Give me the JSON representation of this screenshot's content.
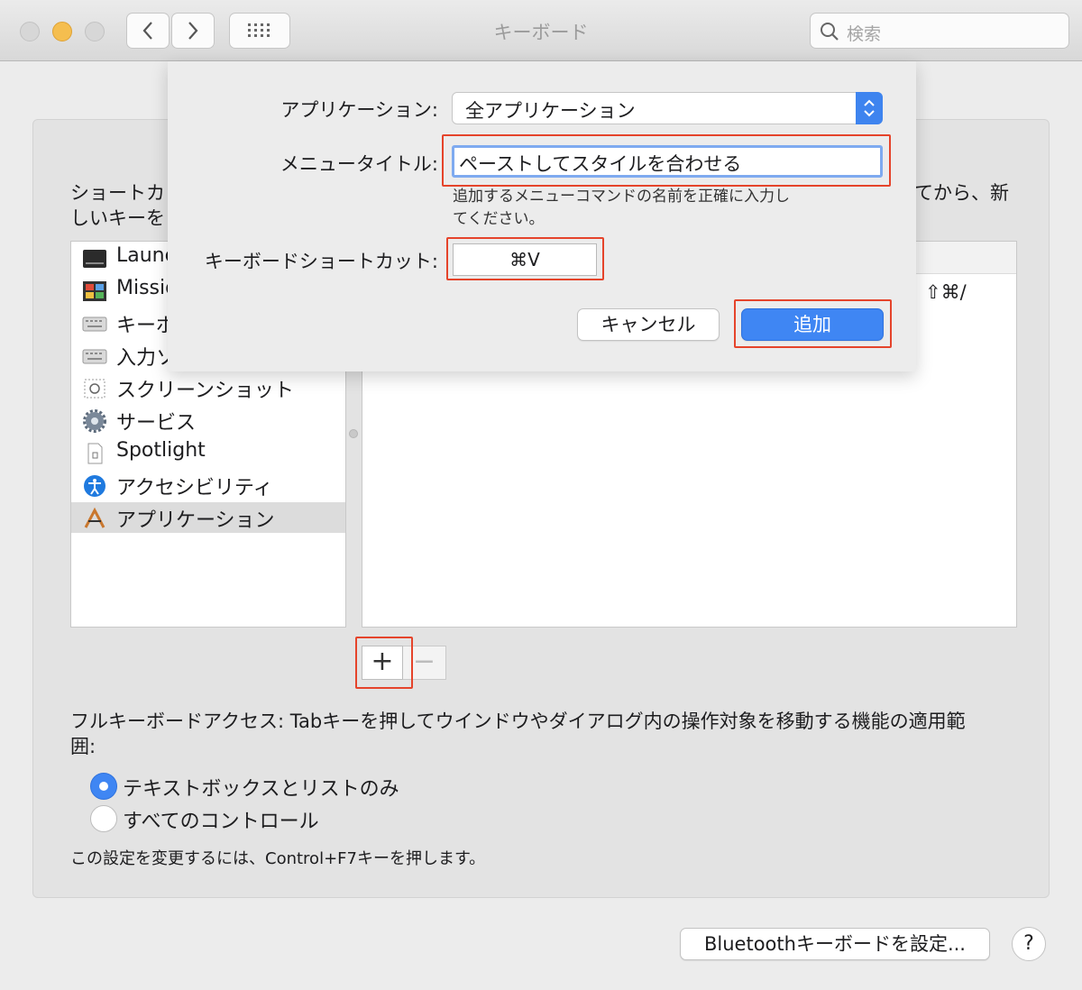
{
  "window": {
    "title": "キーボード",
    "search_placeholder": "検索"
  },
  "toolbar_icons": [
    "back-chevron-icon",
    "forward-chevron-icon",
    "grid-icon"
  ],
  "intro": {
    "line1_left": "ショートカ",
    "line1_right": "てから、新",
    "line2_left": "しいキーを"
  },
  "categories": [
    {
      "label": "Launc",
      "icon": "launchpad-icon"
    },
    {
      "label": "Missio",
      "icon": "mission-control-icon"
    },
    {
      "label": "キーボ",
      "icon": "keyboard-icon"
    },
    {
      "label": "入力ソ",
      "icon": "input-source-icon"
    },
    {
      "label": "スクリーンショット",
      "icon": "screenshot-icon"
    },
    {
      "label": "サービス",
      "icon": "services-gear-icon"
    },
    {
      "label": "Spotlight",
      "icon": "spotlight-doc-icon"
    },
    {
      "label": "アクセシビリティ",
      "icon": "accessibility-icon"
    },
    {
      "label": "アプリケーション",
      "icon": "applications-icon",
      "selected": true
    }
  ],
  "shortcut_row": {
    "keys": "⇧⌘/"
  },
  "list_buttons": {
    "add": "+",
    "remove": "−"
  },
  "full_keyboard": {
    "description": "フルキーボードアクセス: Tabキーを押してウインドウやダイアログ内の操作対象を移動する機能の適用範囲:",
    "options": [
      {
        "label": "テキストボックスとリストのみ",
        "selected": true
      },
      {
        "label": "すべてのコントロール",
        "selected": false
      }
    ],
    "note": "この設定を変更するには、Control+F7キーを押します。"
  },
  "bluetooth_button": "Bluetoothキーボードを設定...",
  "help_button": "?",
  "sheet": {
    "application_label": "アプリケーション:",
    "application_value": "全アプリケーション",
    "menu_title_label": "メニュータイトル:",
    "menu_title_value": "ペーストしてスタイルを合わせる",
    "hint": "追加するメニューコマンドの名前を正確に入力してください。",
    "shortcut_label": "キーボードショートカット:",
    "shortcut_value": "⌘V",
    "cancel": "キャンセル",
    "add": "追加"
  },
  "colors": {
    "accent": "#3f86f3",
    "highlight": "#e5442b"
  }
}
